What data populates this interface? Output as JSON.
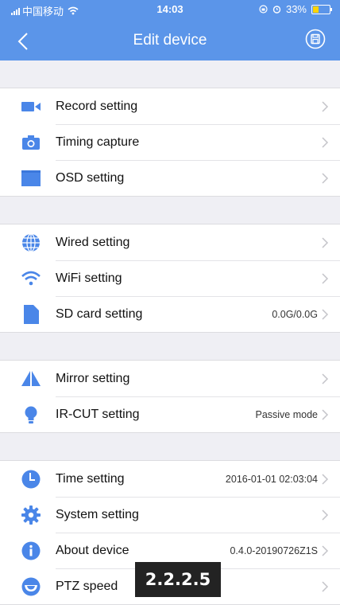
{
  "status_bar": {
    "carrier": "中国移动",
    "time": "14:03",
    "battery": "33%"
  },
  "nav": {
    "title": "Edit device",
    "back_icon": "chevron-left-icon",
    "save_icon": "floppy-disk-icon"
  },
  "colors": {
    "header_bg": "#5b95e9",
    "icon_blue": "#4a86e8"
  },
  "groups": [
    {
      "items": [
        {
          "label": "Record setting",
          "icon": "video-camera-icon",
          "value": ""
        },
        {
          "label": "Timing capture",
          "icon": "camera-icon",
          "value": ""
        },
        {
          "label": "OSD setting",
          "icon": "folder-icon",
          "value": ""
        }
      ]
    },
    {
      "items": [
        {
          "label": "Wired setting",
          "icon": "globe-icon",
          "value": ""
        },
        {
          "label": "WiFi setting",
          "icon": "wifi-icon",
          "value": ""
        },
        {
          "label": "SD card setting",
          "icon": "sd-card-icon",
          "value": "0.0G/0.0G"
        }
      ]
    },
    {
      "items": [
        {
          "label": "Mirror setting",
          "icon": "mirror-icon",
          "value": ""
        },
        {
          "label": "IR-CUT setting",
          "icon": "bulb-icon",
          "value": "Passive mode"
        }
      ]
    },
    {
      "items": [
        {
          "label": "Time setting",
          "icon": "clock-icon",
          "value": "2016-01-01 02:03:04"
        },
        {
          "label": "System setting",
          "icon": "gear-icon",
          "value": ""
        },
        {
          "label": "About device",
          "icon": "info-icon",
          "value": "0.4.0-20190726Z1S"
        },
        {
          "label": "PTZ speed",
          "icon": "ptz-icon",
          "value": ""
        }
      ]
    }
  ],
  "overlay_badge": "2.2.2.5"
}
